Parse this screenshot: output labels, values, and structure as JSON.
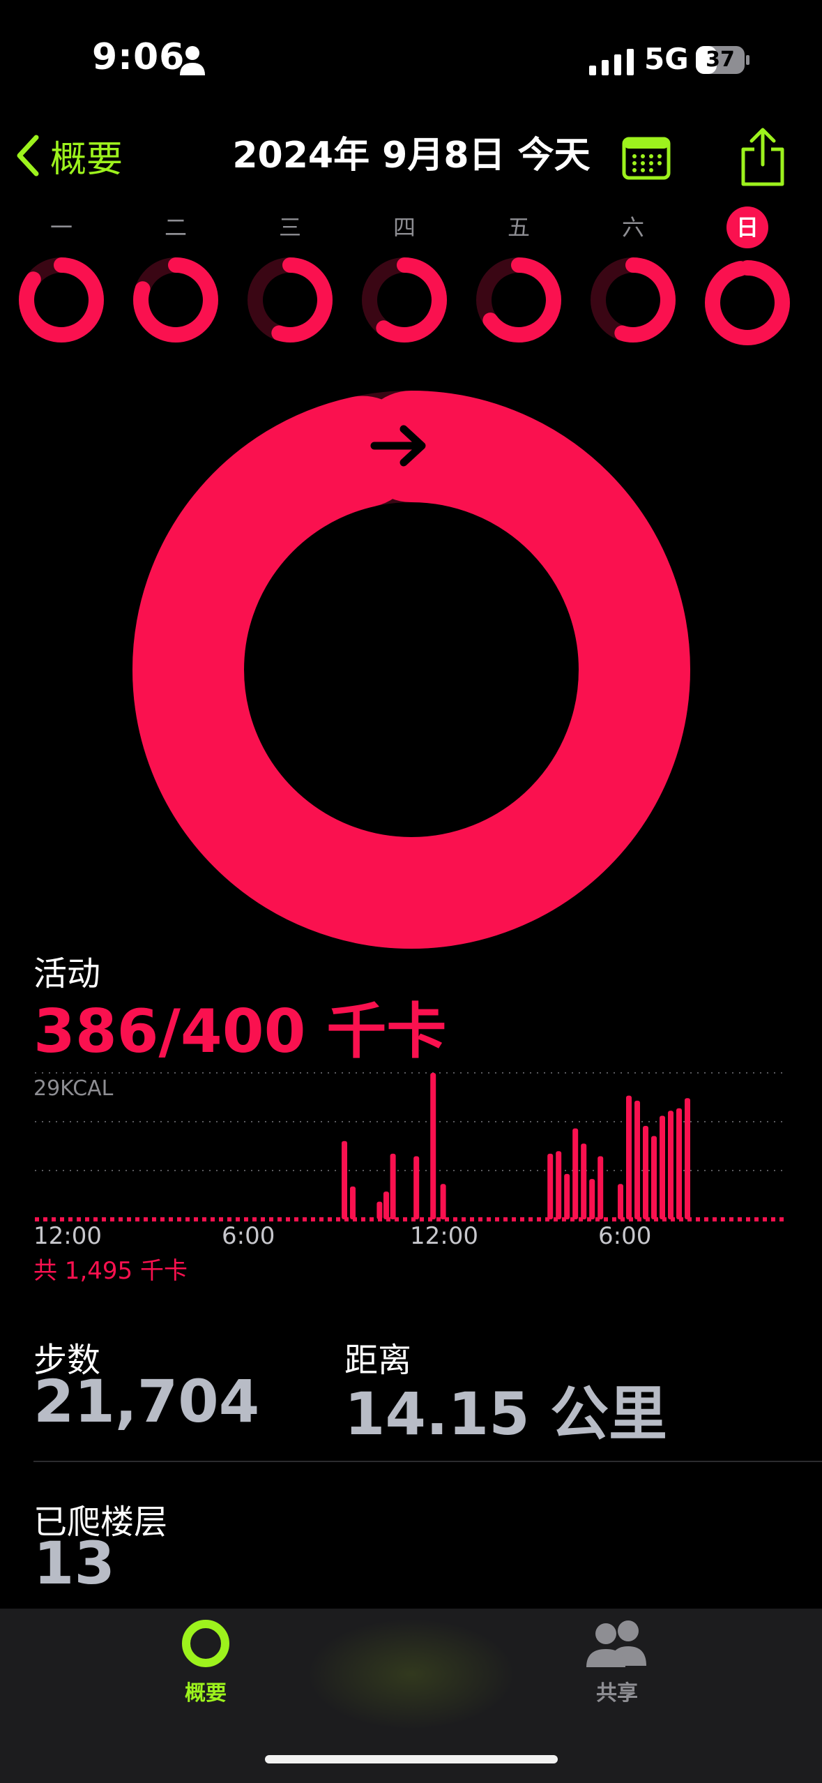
{
  "status_bar": {
    "time": "9:06",
    "network": "5G",
    "battery": "37"
  },
  "nav": {
    "back_label": "概要",
    "title": "2024年 9月8日 今天"
  },
  "week": {
    "days": [
      {
        "label": "一",
        "progress": 0.85,
        "today": false
      },
      {
        "label": "二",
        "progress": 0.8,
        "today": false
      },
      {
        "label": "三",
        "progress": 0.55,
        "today": false
      },
      {
        "label": "四",
        "progress": 0.6,
        "today": false
      },
      {
        "label": "五",
        "progress": 0.65,
        "today": false
      },
      {
        "label": "六",
        "progress": 0.55,
        "today": false
      },
      {
        "label": "日",
        "progress": 0.965,
        "today": true
      }
    ]
  },
  "activity": {
    "label": "活动",
    "value_text": "386/400 千卡",
    "current": 386,
    "goal": 400,
    "chart_max_label": "29KCAL",
    "total_text": "共 1,495 千卡"
  },
  "chart_data": {
    "type": "bar",
    "title": "",
    "ylabel": "29KCAL",
    "x_tick_labels": [
      "12:00",
      "6:00",
      "12:00",
      "6:00"
    ],
    "bar_hours": [
      9.25,
      9.5,
      10.3,
      10.5,
      10.7,
      11.4,
      11.9,
      12.2,
      15.4,
      15.65,
      15.9,
      16.15,
      16.4,
      16.65,
      16.9,
      17.5,
      17.75,
      18.0,
      18.25,
      18.5,
      18.75,
      19.0,
      19.25,
      19.5
    ],
    "values": [
      15.5,
      6.5,
      3.5,
      5.5,
      13,
      12.5,
      29,
      7,
      13,
      13.5,
      9,
      18,
      15,
      8,
      12.5,
      7,
      24.5,
      23.5,
      18.5,
      16.5,
      20.5,
      21.5,
      22,
      24
    ],
    "ylim": [
      0,
      29
    ],
    "xlim_hours": [
      0,
      22.5
    ],
    "unit": "kcal",
    "color": "#fa114f"
  },
  "stats": {
    "steps": {
      "label": "步数",
      "value": "21,704"
    },
    "distance": {
      "label": "距离",
      "value": "14.15 公里"
    },
    "floors": {
      "label": "已爬楼层",
      "value": "13"
    }
  },
  "tabbar": {
    "summary_label": "概要",
    "sharing_label": "共享"
  },
  "colors": {
    "move": "#fa114f",
    "accent": "#9df21d",
    "stat_value": "#b8bcc6"
  }
}
